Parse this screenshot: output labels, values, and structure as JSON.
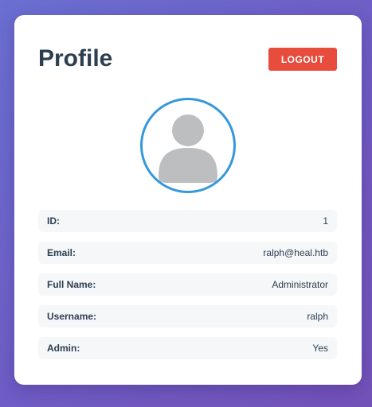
{
  "profile": {
    "title": "Profile",
    "logout_label": "LOGOUT",
    "avatar_icon": "user-silhouette-icon",
    "fields": [
      {
        "label": "ID:",
        "value": "1"
      },
      {
        "label": "Email:",
        "value": "ralph@heal.htb"
      },
      {
        "label": "Full Name:",
        "value": "Administrator"
      },
      {
        "label": "Username:",
        "value": "ralph"
      },
      {
        "label": "Admin:",
        "value": "Yes"
      }
    ]
  },
  "colors": {
    "accent_blue": "#3498db",
    "logout_red": "#e74c3c",
    "title_text": "#2c3e50",
    "row_background": "#f5f7f9",
    "page_gradient_start": "#6a6fd1",
    "page_gradient_end": "#7352b8"
  }
}
